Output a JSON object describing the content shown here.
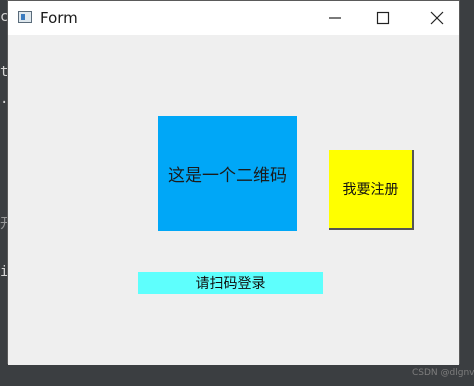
{
  "window": {
    "title": "Form",
    "minimize_icon": "minimize-icon",
    "maximize_icon": "maximize-icon",
    "close_icon": "close-icon"
  },
  "background_editor": {
    "margin_chars": [
      "c",
      "t",
      ".",
      "开",
      "i"
    ]
  },
  "content": {
    "qr_placeholder_text": "这是一个二维码",
    "register_button_label": "我要注册",
    "scan_login_label": "请扫码登录"
  },
  "watermark": "CSDN @dlgnve",
  "colors": {
    "qr_bg": "#00a7f7",
    "register_bg": "#ffff00",
    "scan_label_bg": "#5efffd",
    "window_bg": "#efefef"
  }
}
